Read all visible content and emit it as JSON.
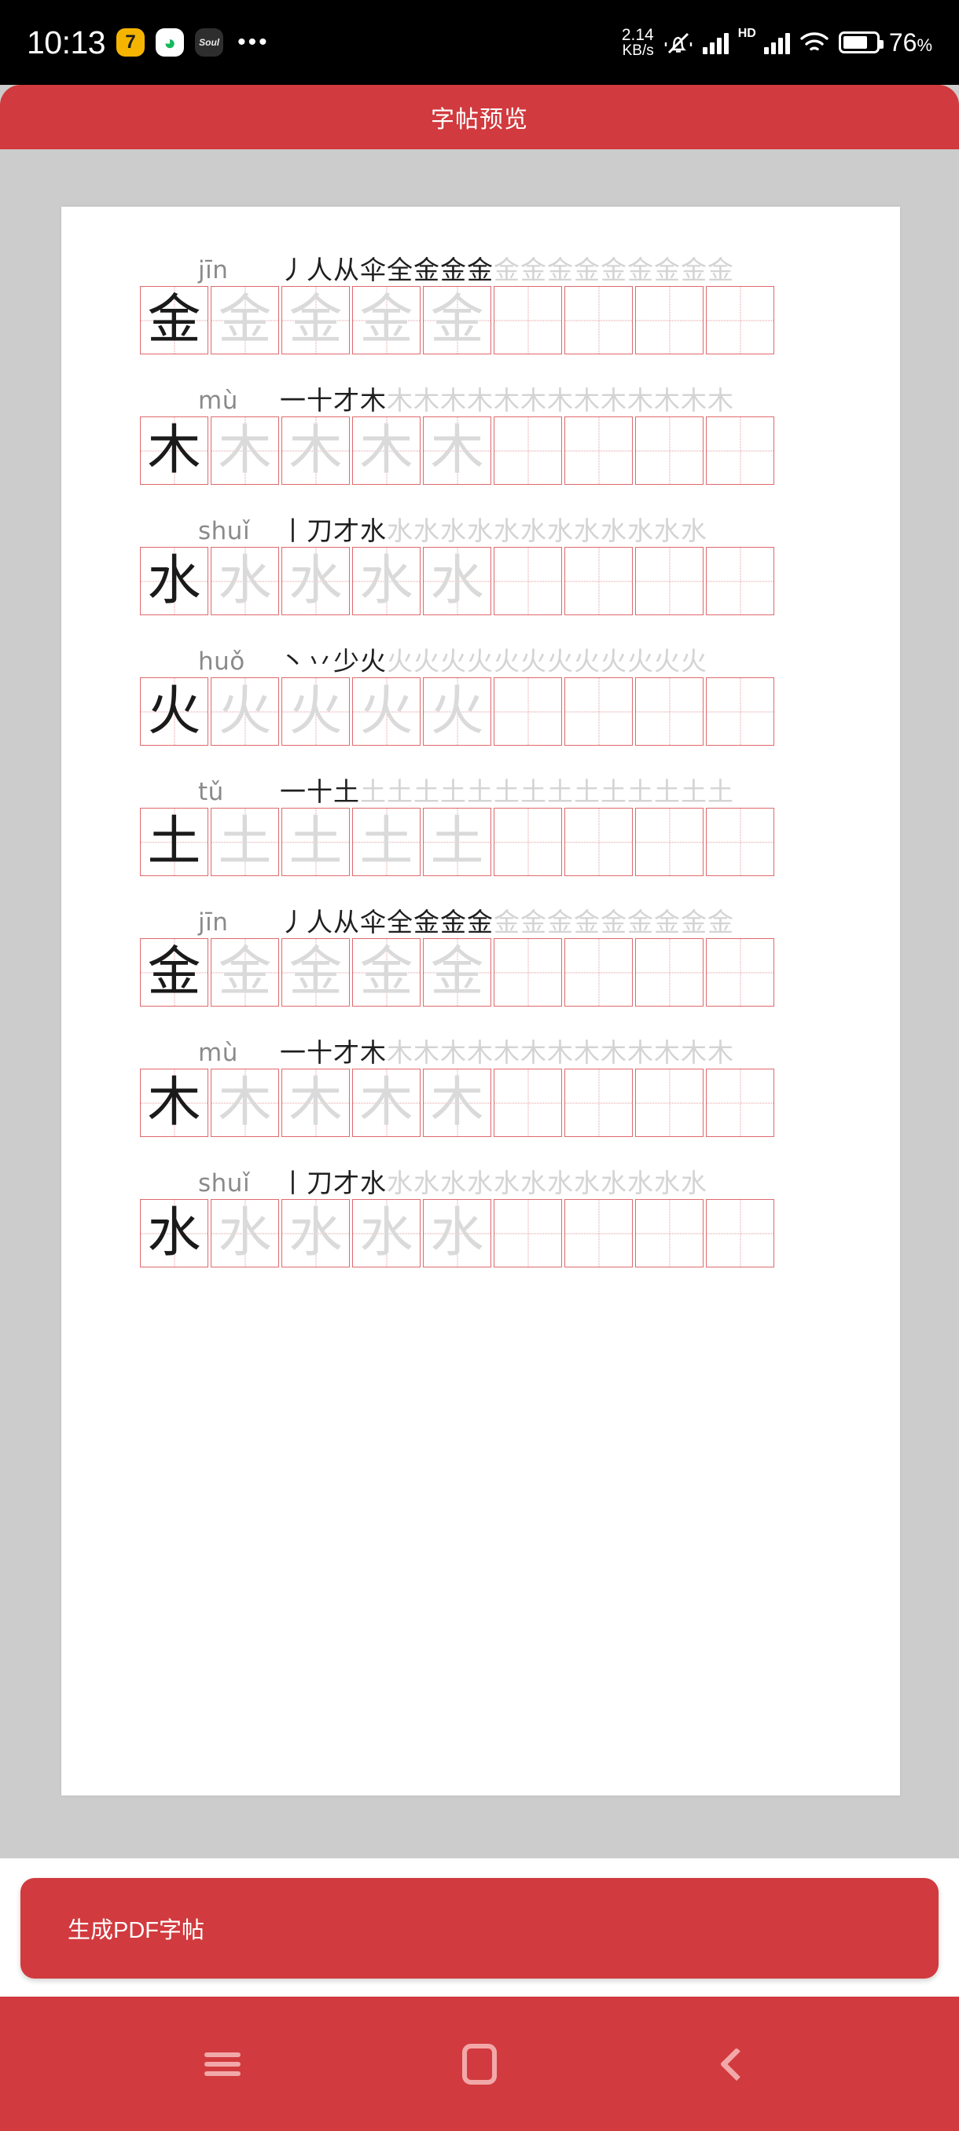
{
  "status_bar": {
    "time": "10:13",
    "app_icons": [
      "cat-7-icon",
      "green-swirl-icon",
      "soul-icon"
    ],
    "overflow_dots": "•••",
    "network_speed_value": "2.14",
    "network_speed_unit": "KB/s",
    "mute_icon": "bell-muted-icon",
    "signal_1": "signal-bars-icon",
    "hd_label": "HD",
    "signal_2": "signal-bars-icon",
    "wifi": "wifi-icon",
    "battery_icon": "battery-icon",
    "battery_percent": "76",
    "battery_percent_symbol": "%"
  },
  "app_bar": {
    "title": "字帖预览"
  },
  "colors": {
    "brand_red": "#D13A3E",
    "page_background": "#cccccc",
    "paper": "#ffffff",
    "grid_border": "#e0696c",
    "grid_guide": "#e39a9d",
    "pinyin_gray": "#8a8a8a",
    "ghost_stroke": "#d4d4d4",
    "dark_glyph": "#1a1a1a",
    "faint_glyph": "#dadada",
    "nav_icon": "#F2A8A8"
  },
  "worksheet": {
    "cells_per_row": 9,
    "rows": [
      {
        "pinyin": "jīn",
        "character": "金",
        "stroke_build": [
          "丿",
          "人",
          "从",
          "伞",
          "全",
          "金",
          "金",
          "金"
        ],
        "stroke_ghost": [
          "金",
          "金",
          "金",
          "金",
          "金",
          "金",
          "金",
          "金",
          "金"
        ],
        "cells": [
          "dark",
          "faint",
          "faint",
          "faint",
          "faint",
          "empty",
          "empty",
          "empty",
          "empty"
        ]
      },
      {
        "pinyin": "mù",
        "character": "木",
        "stroke_build": [
          "一",
          "十",
          "才",
          "木"
        ],
        "stroke_ghost": [
          "木",
          "木",
          "木",
          "木",
          "木",
          "木",
          "木",
          "木",
          "木",
          "木",
          "木",
          "木",
          "木"
        ],
        "cells": [
          "dark",
          "faint",
          "faint",
          "faint",
          "faint",
          "empty",
          "empty",
          "empty",
          "empty"
        ]
      },
      {
        "pinyin": "shuǐ",
        "character": "水",
        "stroke_build": [
          "丨",
          "刀",
          "才",
          "水"
        ],
        "stroke_ghost": [
          "水",
          "水",
          "水",
          "水",
          "水",
          "水",
          "水",
          "水",
          "水",
          "水",
          "水",
          "水"
        ],
        "cells": [
          "dark",
          "faint",
          "faint",
          "faint",
          "faint",
          "empty",
          "empty",
          "empty",
          "empty"
        ]
      },
      {
        "pinyin": "huǒ",
        "character": "火",
        "stroke_build": [
          "丶",
          "丷",
          "少",
          "火"
        ],
        "stroke_ghost": [
          "火",
          "火",
          "火",
          "火",
          "火",
          "火",
          "火",
          "火",
          "火",
          "火",
          "火",
          "火"
        ],
        "cells": [
          "dark",
          "faint",
          "faint",
          "faint",
          "faint",
          "empty",
          "empty",
          "empty",
          "empty"
        ]
      },
      {
        "pinyin": "tǔ",
        "character": "土",
        "stroke_build": [
          "一",
          "十",
          "土"
        ],
        "stroke_ghost": [
          "土",
          "土",
          "土",
          "土",
          "土",
          "土",
          "土",
          "土",
          "土",
          "土",
          "土",
          "土",
          "土",
          "土"
        ],
        "cells": [
          "dark",
          "faint",
          "faint",
          "faint",
          "faint",
          "empty",
          "empty",
          "empty",
          "empty"
        ]
      },
      {
        "pinyin": "jīn",
        "character": "金",
        "stroke_build": [
          "丿",
          "人",
          "从",
          "伞",
          "全",
          "金",
          "金",
          "金"
        ],
        "stroke_ghost": [
          "金",
          "金",
          "金",
          "金",
          "金",
          "金",
          "金",
          "金",
          "金"
        ],
        "cells": [
          "dark",
          "faint",
          "faint",
          "faint",
          "faint",
          "empty",
          "empty",
          "empty",
          "empty"
        ]
      },
      {
        "pinyin": "mù",
        "character": "木",
        "stroke_build": [
          "一",
          "十",
          "才",
          "木"
        ],
        "stroke_ghost": [
          "木",
          "木",
          "木",
          "木",
          "木",
          "木",
          "木",
          "木",
          "木",
          "木",
          "木",
          "木",
          "木"
        ],
        "cells": [
          "dark",
          "faint",
          "faint",
          "faint",
          "faint",
          "empty",
          "empty",
          "empty",
          "empty"
        ]
      },
      {
        "pinyin": "shuǐ",
        "character": "水",
        "stroke_build": [
          "丨",
          "刀",
          "才",
          "水"
        ],
        "stroke_ghost": [
          "水",
          "水",
          "水",
          "水",
          "水",
          "水",
          "水",
          "水",
          "水",
          "水",
          "水",
          "水"
        ],
        "cells": [
          "dark",
          "faint",
          "faint",
          "faint",
          "faint",
          "empty",
          "empty",
          "empty",
          "empty"
        ]
      }
    ]
  },
  "bottom": {
    "generate_button_label": "生成PDF字帖"
  },
  "nav_bar": {
    "menu_label": "menu-icon",
    "home_label": "home-icon",
    "back_label": "back-icon"
  }
}
